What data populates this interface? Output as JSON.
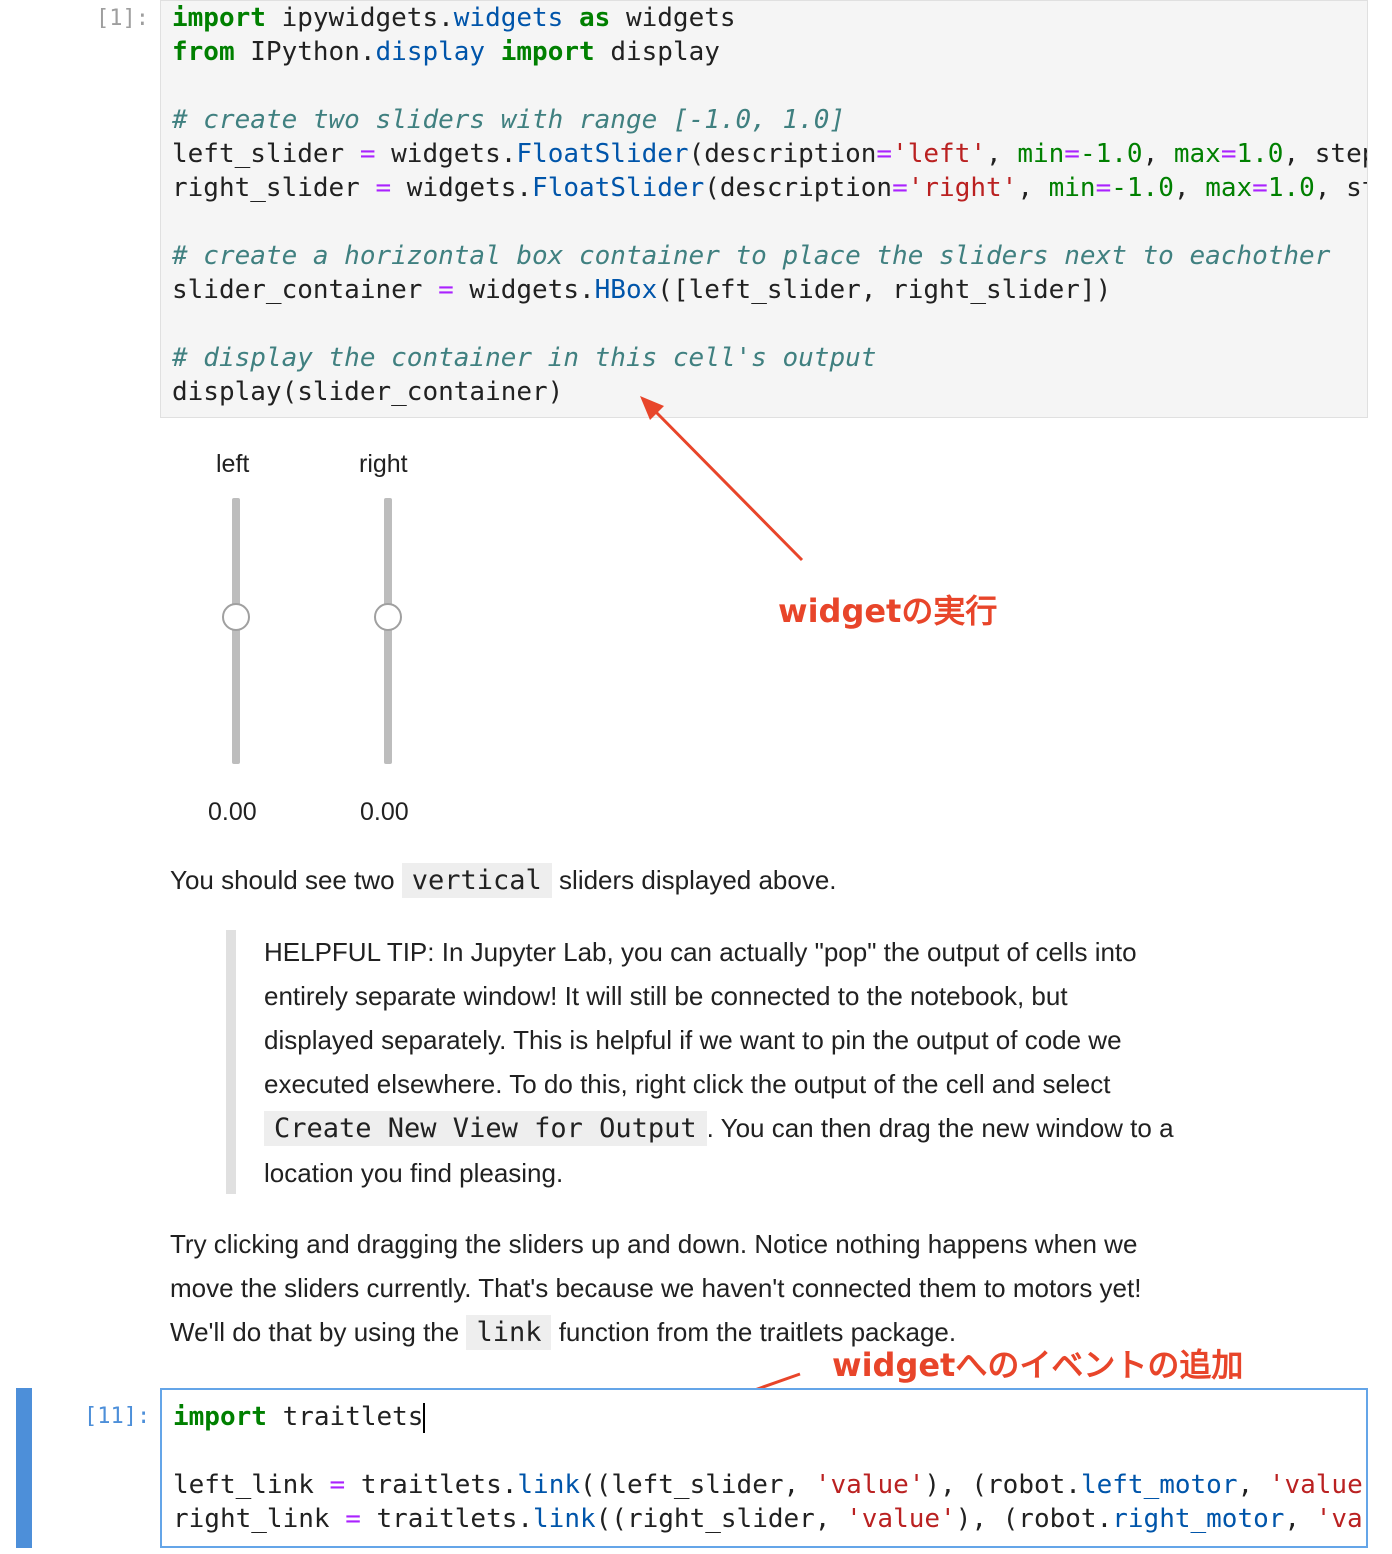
{
  "cell1": {
    "prompt": "[1]:",
    "code": {
      "l1": {
        "kw1": "import",
        "mod": " ipywidgets.",
        "attr": "widgets",
        "sp": " ",
        "kw2": "as",
        "alias": " widgets"
      },
      "l2": {
        "kw1": "from",
        "mod": " IPython.",
        "attr": "display",
        "sp": " ",
        "kw2": "import",
        "name": " display"
      },
      "l4": "# create two sliders with range [-1.0, 1.0]",
      "l5": {
        "var": "left_slider ",
        "eq": "=",
        "obj": " widgets.",
        "cls": "FloatSlider",
        "arg1": "(description",
        "eq2": "=",
        "str": "'left'",
        "c1": ", ",
        "minkw": "min",
        "eq3": "=",
        "minval": "-1.0",
        "c2": ", ",
        "maxkw": "max",
        "eq4": "=",
        "maxval": "1.0",
        "c3": ", ",
        "rest": "step"
      },
      "l6": {
        "var": "right_slider ",
        "eq": "=",
        "obj": " widgets.",
        "cls": "FloatSlider",
        "arg1": "(description",
        "eq2": "=",
        "str": "'right'",
        "c1": ", ",
        "minkw": "min",
        "eq3": "=",
        "minval": "-1.0",
        "c2": ", ",
        "maxkw": "max",
        "eq4": "=",
        "maxval": "1.0",
        "c3": ", ",
        "rest": "st"
      },
      "l8": "# create a horizontal box container to place the sliders next to eachother",
      "l9": {
        "var": "slider_container ",
        "eq": "=",
        "obj": " widgets.",
        "cls": "HBox",
        "rest": "([left_slider, right_slider])"
      },
      "l11": "# display the container in this cell's output",
      "l12": "display(slider_container)"
    }
  },
  "sliders": {
    "left": {
      "label": "left",
      "value_text": "0.00",
      "value": 0.0,
      "min": -1.0,
      "max": 1.0
    },
    "right": {
      "label": "right",
      "value_text": "0.00",
      "value": 0.0,
      "min": -1.0,
      "max": 1.0
    }
  },
  "markdown": {
    "p1_before": "You should see two ",
    "p1_code": "vertical",
    "p1_after": " sliders displayed above.",
    "tip": {
      "l1": "HELPFUL TIP: In Jupyter Lab, you can actually \"pop\" the output of cells into",
      "l2": "entirely separate window! It will still be connected to the notebook, but",
      "l3": "displayed separately. This is helpful if we want to pin the output of code we",
      "l4": "executed elsewhere. To do this, right click the output of the cell and select",
      "l5_code": "Create New View for Output",
      "l5_after": ". You can then drag the new window to a",
      "l6": "location you find pleasing."
    },
    "p2": {
      "l1": "Try clicking and dragging the sliders up and down. Notice nothing happens when we",
      "l2": "move the sliders currently. That's because we haven't connected them to motors yet!",
      "l3_before": "We'll do that by using the ",
      "l3_code": "link",
      "l3_after": " function from the traitlets package."
    }
  },
  "cell2": {
    "prompt": "[11]:",
    "code": {
      "l1": {
        "kw": "import",
        "mod": " traitlets"
      },
      "l3": {
        "var": "left_link ",
        "eq": "=",
        "obj": " traitlets.",
        "fn": "link",
        "p1": "((left_slider, ",
        "str1": "'value'",
        "p2": "), (robot.",
        "attr": "left_motor",
        "p3": ", ",
        "str2": "'value"
      },
      "l4": {
        "var": "right_link ",
        "eq": "=",
        "obj": " traitlets.",
        "fn": "link",
        "p1": "((right_slider, ",
        "str1": "'value'",
        "p2": "), (robot.",
        "attr": "right_motor",
        "p3": ", ",
        "str2": "'va"
      }
    }
  },
  "annotations": {
    "widget_run": "widgetの実行",
    "widget_event": "widgetへのイベントの追加"
  },
  "colors": {
    "annotation": "#e8452a",
    "active_cell": "#64a5e8",
    "collapser": "#4d8fd9"
  }
}
